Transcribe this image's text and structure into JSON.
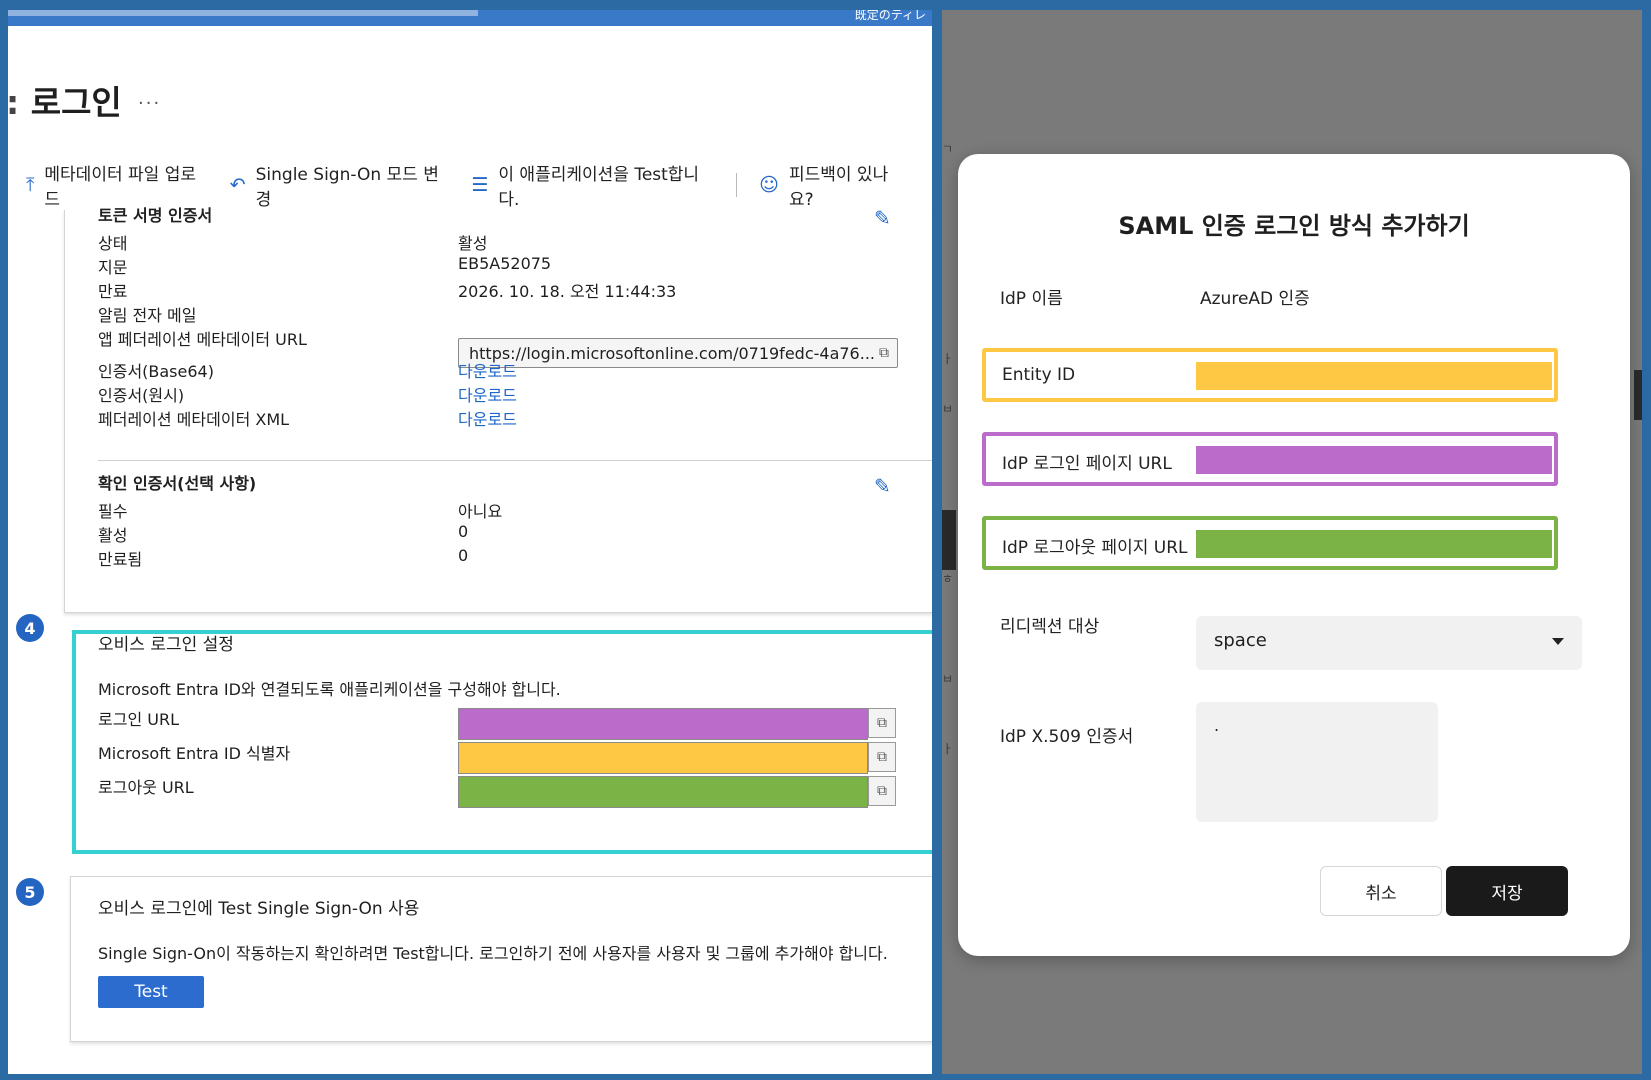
{
  "left": {
    "top_cut_text": "既定のティレ",
    "page_title": "로그인",
    "more_label": "...",
    "toolbar": {
      "upload": "메타데이터 파일 업로드",
      "change_mode": "Single Sign-On 모드 변경",
      "test_app": "이 애플리케이션을 Test합니다.",
      "feedback": "피드백이 있나요?"
    },
    "token_cert": {
      "heading": "토큰 서명 인증서",
      "rows": [
        {
          "label": "상태",
          "value": "활성"
        },
        {
          "label": "지문",
          "value": "EB5A52075"
        },
        {
          "label": "만료",
          "value": "2026. 10. 18. 오전 11:44:33"
        },
        {
          "label": "알림 전자 메일",
          "value": ""
        }
      ],
      "metadata_url_label": "앱 페더레이션 메타데이터 URL",
      "metadata_url_value": "https://login.microsoftonline.com/0719fedc-4a76...",
      "downloads": [
        {
          "label": "인증서(Base64)",
          "value": "다운로드"
        },
        {
          "label": "인증서(원시)",
          "value": "다운로드"
        },
        {
          "label": "페더레이션 메타데이터 XML",
          "value": "다운로드"
        }
      ]
    },
    "verify_cert": {
      "heading": "확인 인증서(선택 사항)",
      "rows": [
        {
          "label": "필수",
          "value": "아니요"
        },
        {
          "label": "활성",
          "value": "0"
        },
        {
          "label": "만료됨",
          "value": "0"
        }
      ]
    },
    "step4": {
      "number": "4",
      "title": "오비스 로그인 설정",
      "desc": "Microsoft Entra ID와 연결되도록 애플리케이션을 구성해야 합니다.",
      "fields": [
        {
          "label": "로그인 URL",
          "color": "#bb6bc9"
        },
        {
          "label": "Microsoft Entra ID 식별자",
          "color": "#fec844"
        },
        {
          "label": "로그아웃 URL",
          "color": "#7cb347"
        }
      ]
    },
    "step5": {
      "number": "5",
      "title": "오비스 로그인에 Test Single Sign-On 사용",
      "desc": "Single Sign-On이 작동하는지 확인하려면 Test합니다. 로그인하기 전에 사용자를 사용자 및 그룹에 추가해야 합니다.",
      "button": "Test"
    }
  },
  "modal": {
    "title": "SAML 인증 로그인 방식 추가하기",
    "idp_name_label": "IdP 이름",
    "idp_name_value": "AzureAD 인증",
    "entity_id_label": "Entity ID",
    "login_url_label": "IdP 로그인 페이지 URL",
    "logout_url_label": "IdP 로그아웃 페이지 URL",
    "redirect_label": "리디렉션 대상",
    "redirect_value": "space",
    "x509_label": "IdP X.509 인증서",
    "x509_value": ".",
    "cancel": "취소",
    "save": "저장"
  },
  "colors": {
    "yellow": "#fec844",
    "purple": "#bb6bc9",
    "green": "#7cb347",
    "teal": "#34d0d2",
    "accent": "#2569c7"
  }
}
